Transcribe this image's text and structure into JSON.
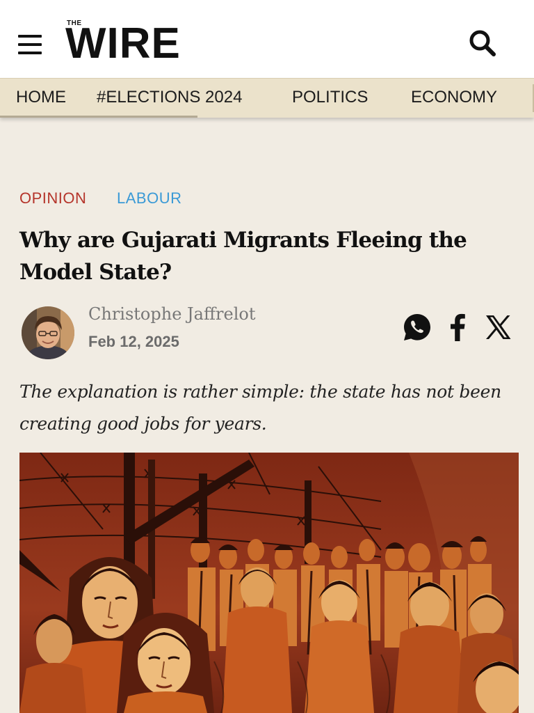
{
  "header": {
    "logo_small": "THE",
    "logo_main": "WIRE",
    "menu_icon": "hamburger-menu-icon",
    "search_icon": "search-icon"
  },
  "nav": {
    "items": [
      "HOME",
      "#ELECTIONS 2024",
      "POLITICS",
      "ECONOMY"
    ]
  },
  "article": {
    "categories": [
      {
        "label": "OPINION",
        "color": "#b5352b"
      },
      {
        "label": "LABOUR",
        "color": "#3b9ad6"
      }
    ],
    "headline": "Why are Gujarati Migrants Fleeing the Model State?",
    "author": "Christophe Jaffrelot",
    "date": "Feb 12, 2025",
    "share_icons": [
      "whatsapp-icon",
      "facebook-icon",
      "x-icon"
    ],
    "standfirst": "The explanation is rather simple: the state has not been creating good jobs for years."
  },
  "colors": {
    "page_background": "#f1ece3",
    "nav_background": "#ebe2cb",
    "header_background": "#ffffff",
    "hero_red": "#8a2c18"
  }
}
